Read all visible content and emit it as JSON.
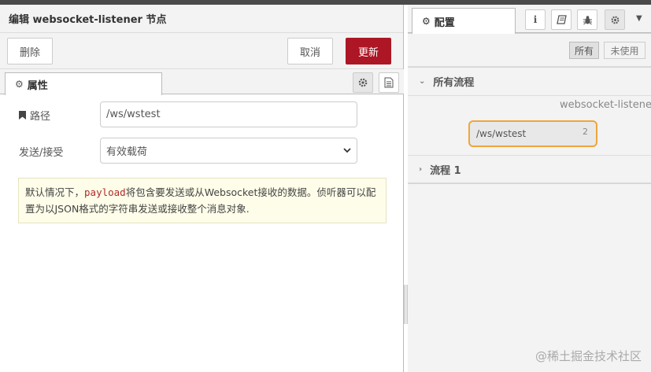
{
  "tray": {
    "title": "编辑 websocket-listener 节点",
    "delete_label": "删除",
    "cancel_label": "取消",
    "update_label": "更新",
    "tab_properties": "属性"
  },
  "form": {
    "path_label": "路径",
    "path_value": "/ws/wstest",
    "send_label": "发送/接受",
    "send_value": "有效载荷",
    "tip_before": "默认情况下，",
    "tip_code": "payload",
    "tip_after": "将包含要发送或从Websocket接收的数据。侦听器可以配置为以JSON格式的字符串发送或接收整个消息对象."
  },
  "sidebar": {
    "tab_config": "配置",
    "filter_all": "所有",
    "filter_unused": "未使用",
    "section_all_flows": "所有流程",
    "node_type": "websocket-listener",
    "config_node_label": "/ws/wstest",
    "config_node_count": "2",
    "section_flow1": "流程 1",
    "watermark": "@稀土掘金技术社区"
  },
  "colors": {
    "accent_red": "#ad1625",
    "highlight_orange": "#f0a53a"
  }
}
